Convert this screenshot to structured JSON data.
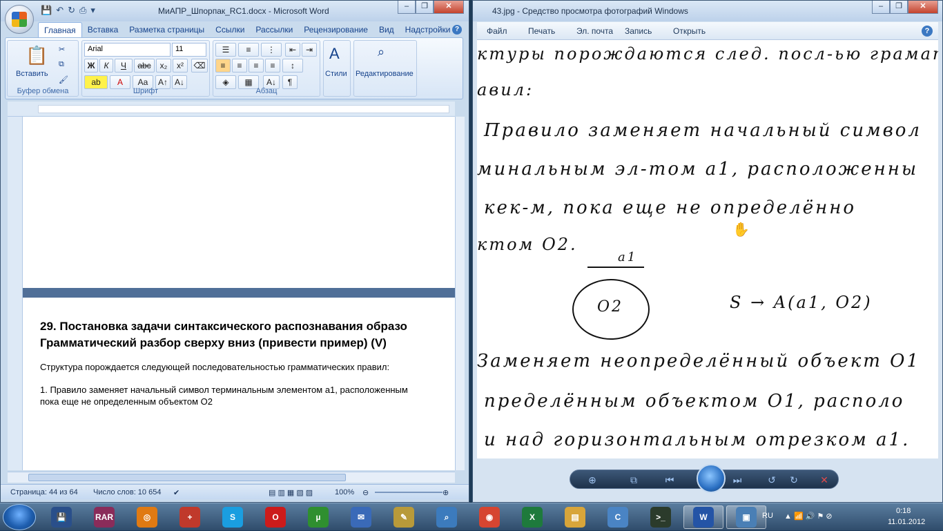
{
  "word": {
    "title": "МиАПР_Шпорпак_RC1.docx - Microsoft Word",
    "tabs": [
      "Главная",
      "Вставка",
      "Разметка страницы",
      "Ссылки",
      "Рассылки",
      "Рецензирование",
      "Вид",
      "Надстройки"
    ],
    "clipboard": {
      "paste": "Вставить",
      "label": "Буфер обмена"
    },
    "font": {
      "name": "Arial",
      "size": "11",
      "label": "Шрифт"
    },
    "paragraph": {
      "label": "Абзац"
    },
    "styles": {
      "label": "Стили"
    },
    "editing": {
      "label": "Редактирование"
    },
    "doc": {
      "heading_line1": "29.     Постановка задачи синтаксического распознавания образо",
      "heading_line2": "Грамматический разбор   сверху вниз (привести пример) (V)",
      "para1": "Структура порождается следующей последовательностью грамматических правил:",
      "para2_line1": "1. Правило заменяет начальный символ терминальным элементом а1, расположенным",
      "para2_line2": "пока еще не определенным объектом О2"
    },
    "status": {
      "page": "Страница: 44 из 64",
      "words": "Число слов: 10 654",
      "zoom": "100%"
    }
  },
  "viewer": {
    "title": "43.jpg - Средство просмотра фотографий Windows",
    "menu": [
      "Файл",
      "Печать",
      "Эл. почта",
      "Запись",
      "Открыть"
    ],
    "handwriting": [
      "ктуры порождаются след. посл-ью грамат.",
      "авил:",
      "Правило заменяет начальный символ",
      "минальным эл-том а1, расположенны",
      "кек-м, пока еще не определённо",
      "ктом О2.",
      "а1",
      "О2",
      "S → A(a1, O2)",
      "Заменяет неопределённый объект О1",
      "пределённым объектом О1, располо",
      "и над горизонтальным отрезком а1."
    ]
  },
  "taskbar": {
    "lang": "RU",
    "time": "0:18",
    "date": "11.01.2012",
    "apps": [
      {
        "name": "save-app-icon",
        "label": "💾",
        "color": "#2a4f8a"
      },
      {
        "name": "winrar-icon",
        "label": "RAR",
        "color": "#8a2c5a"
      },
      {
        "name": "app-swirl-icon",
        "label": "◎",
        "color": "#e07a12"
      },
      {
        "name": "plus-app-icon",
        "label": "+",
        "color": "#c0392b"
      },
      {
        "name": "skype-icon",
        "label": "S",
        "color": "#1a9ee0"
      },
      {
        "name": "opera-icon",
        "label": "O",
        "color": "#cc1b1b"
      },
      {
        "name": "utorrent-icon",
        "label": "µ",
        "color": "#2f8f2f"
      },
      {
        "name": "mail-app-icon",
        "label": "✉",
        "color": "#3a6ab8"
      },
      {
        "name": "notepad-icon",
        "label": "✎",
        "color": "#b89a3a"
      },
      {
        "name": "search-app-icon",
        "label": "⌕",
        "color": "#3c7bbd"
      },
      {
        "name": "chrome-icon",
        "label": "◉",
        "color": "#d64531"
      },
      {
        "name": "excel-icon",
        "label": "X",
        "color": "#1e7a3c"
      },
      {
        "name": "explorer-icon",
        "label": "▤",
        "color": "#d8a53a"
      },
      {
        "name": "ccleaner-icon",
        "label": "C",
        "color": "#4a84c4"
      },
      {
        "name": "console-app-icon",
        "label": ">_",
        "color": "#2b3b2b"
      },
      {
        "name": "word-icon",
        "label": "W",
        "color": "#2454a6"
      },
      {
        "name": "photo-viewer-icon",
        "label": "▣",
        "color": "#4a7fb5"
      }
    ]
  }
}
